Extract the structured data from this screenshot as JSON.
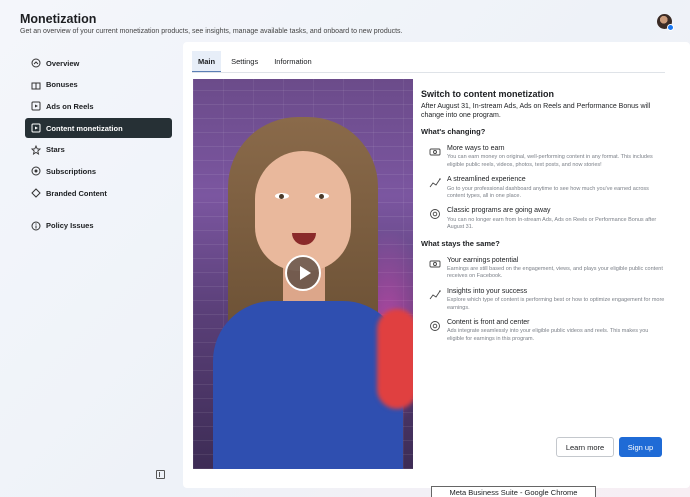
{
  "header": {
    "title": "Monetization",
    "subtitle": "Get an overview of your current monetization products, see insights, manage available tasks, and onboard to new products."
  },
  "sidebar": {
    "items": [
      {
        "label": "Overview",
        "icon": "overview-icon"
      },
      {
        "label": "Bonuses",
        "icon": "bonus-icon"
      },
      {
        "label": "Ads on Reels",
        "icon": "reels-icon"
      },
      {
        "label": "Content monetization",
        "icon": "content-icon",
        "active": true
      },
      {
        "label": "Stars",
        "icon": "star-icon"
      },
      {
        "label": "Subscriptions",
        "icon": "subscriptions-icon"
      },
      {
        "label": "Branded Content",
        "icon": "branded-content-icon"
      },
      {
        "label": "Policy Issues",
        "icon": "info-icon"
      }
    ]
  },
  "tabs": [
    {
      "label": "Main",
      "active": true
    },
    {
      "label": "Settings"
    },
    {
      "label": "Information"
    }
  ],
  "content": {
    "title": "Switch to content monetization",
    "intro": "After August 31, In-stream Ads, Ads on Reels and Performance Bonus will change into one program.",
    "changing_heading": "What's changing?",
    "changing": [
      {
        "title": "More ways to earn",
        "desc": "You can earn money on original, well-performing content in any format. This includes eligible public reels, videos, photos, text posts, and now stories!",
        "icon": "money-icon"
      },
      {
        "title": "A streamlined experience",
        "desc": "Go to your professional dashboard anytime to see how much you've earned across content types, all in one place.",
        "icon": "trend-icon"
      },
      {
        "title": "Classic programs are going away",
        "desc": "You can no longer earn from In-stream Ads, Ads on Reels or Performance Bonus after August 31.",
        "icon": "target-icon"
      }
    ],
    "same_heading": "What stays the same?",
    "same": [
      {
        "title": "Your earnings potential",
        "desc": "Earnings are still based on the engagement, views, and plays your eligible public content receives on Facebook.",
        "icon": "money-icon"
      },
      {
        "title": "Insights into your success",
        "desc": "Explore which type of content is performing best or how to optimize engagement for more earnings.",
        "icon": "trend-icon"
      },
      {
        "title": "Content is front and center",
        "desc": "Ads integrate seamlessly into your eligible public videos and reels. This makes you eligible for earnings in this program.",
        "icon": "target-icon"
      }
    ]
  },
  "buttons": {
    "learn_more": "Learn more",
    "sign_up": "Sign up"
  },
  "tooltip": "Meta Business Suite - Google Chrome",
  "colors": {
    "active_nav": "#263035",
    "primary": "#1f6bd6"
  }
}
